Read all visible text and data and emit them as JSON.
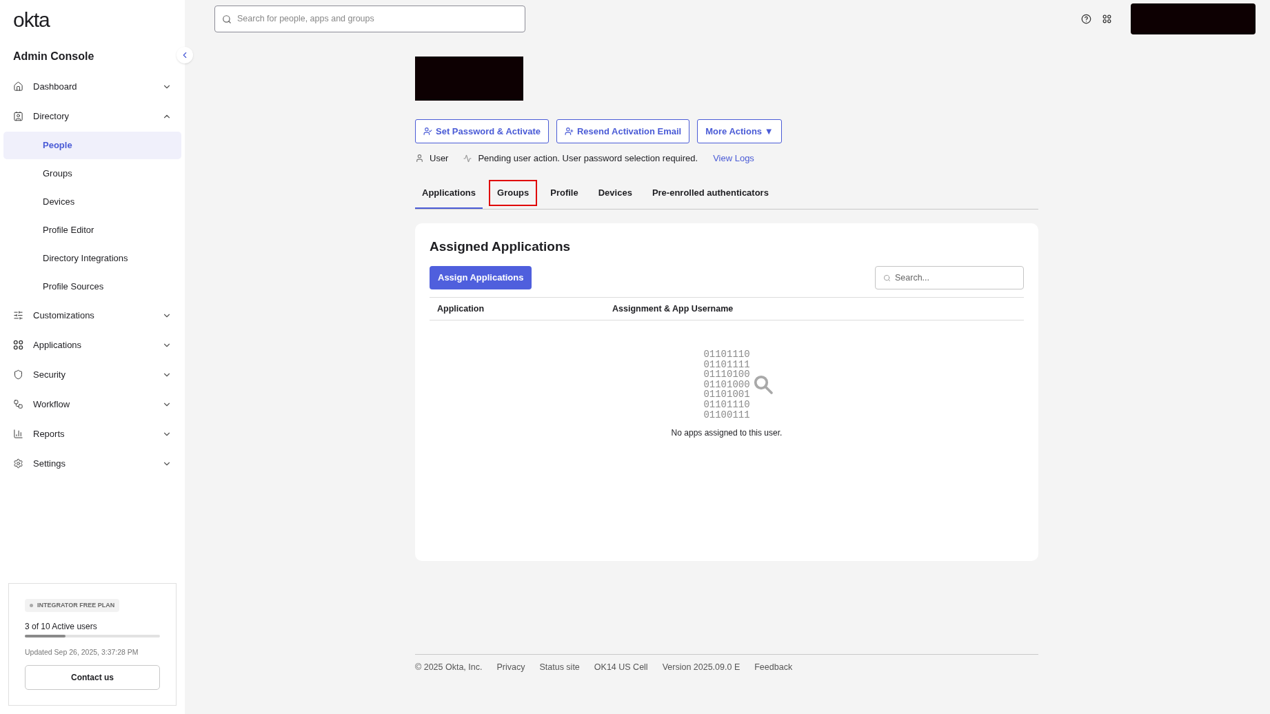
{
  "sidebar": {
    "logo": "okta",
    "title": "Admin Console",
    "items": [
      {
        "label": "Dashboard",
        "expanded": false
      },
      {
        "label": "Directory",
        "expanded": true,
        "children": [
          {
            "label": "People",
            "selected": true
          },
          {
            "label": "Groups",
            "selected": false
          },
          {
            "label": "Devices",
            "selected": false
          },
          {
            "label": "Profile Editor",
            "selected": false
          },
          {
            "label": "Directory Integrations",
            "selected": false
          },
          {
            "label": "Profile Sources",
            "selected": false
          }
        ]
      },
      {
        "label": "Customizations",
        "expanded": false
      },
      {
        "label": "Applications",
        "expanded": false
      },
      {
        "label": "Security",
        "expanded": false
      },
      {
        "label": "Workflow",
        "expanded": false
      },
      {
        "label": "Reports",
        "expanded": false
      },
      {
        "label": "Settings",
        "expanded": false
      }
    ],
    "plan": {
      "badge": "INTEGRATOR FREE PLAN",
      "usage": "3 of 10 Active users",
      "level": 0.3,
      "updated": "Updated Sep 26, 2025, 3:37:28 PM",
      "button": "Contact us"
    }
  },
  "header": {
    "search_placeholder": "Search for people, apps and groups"
  },
  "user": {
    "actions": [
      {
        "label": "Set Password & Activate",
        "kind": "icon"
      },
      {
        "label": "Resend Activation Email",
        "kind": "icon"
      },
      {
        "label": "More Actions ▼",
        "kind": "menu"
      }
    ],
    "type": "User",
    "status": "Pending user action. User password selection required.",
    "logs_link": "View Logs"
  },
  "tabs": [
    {
      "label": "Applications",
      "selected": true,
      "highlighted": false
    },
    {
      "label": "Groups",
      "selected": false,
      "highlighted": true
    },
    {
      "label": "Profile",
      "selected": false,
      "highlighted": false
    },
    {
      "label": "Devices",
      "selected": false,
      "highlighted": false
    },
    {
      "label": "Pre-enrolled authenticators",
      "selected": false,
      "highlighted": false
    }
  ],
  "card": {
    "title": "Assigned Applications",
    "assign_button": "Assign Applications",
    "search_placeholder": "Search...",
    "columns": [
      "Application",
      "Assignment & App Username"
    ],
    "empty_art": [
      "01101110",
      "01101111",
      "01110100",
      "01101000",
      "01101001",
      "01101110",
      "01100111"
    ],
    "empty_message": "No apps assigned to this user."
  },
  "footer": [
    "© 2025 Okta, Inc.",
    "Privacy",
    "Status site",
    "OK14 US Cell",
    "Version 2025.09.0 E",
    "Feedback"
  ]
}
